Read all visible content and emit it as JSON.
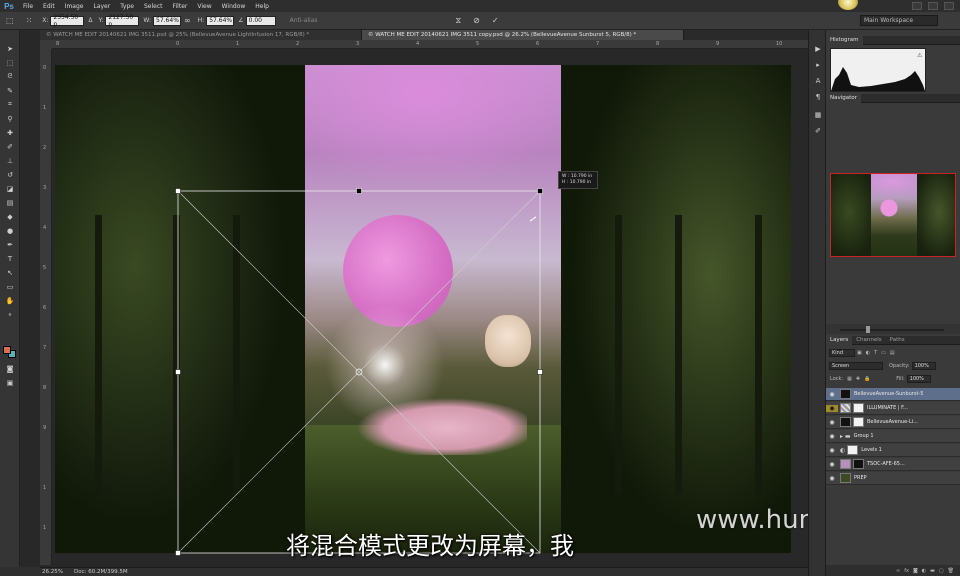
{
  "app": {
    "logo": "Ps",
    "menu": [
      "File",
      "Edit",
      "Image",
      "Layer",
      "Type",
      "Select",
      "Filter",
      "View",
      "Window",
      "Help"
    ]
  },
  "options": {
    "x_label": "X:",
    "x_value": "2554.50 p",
    "y_label": "Y:",
    "y_value": "2127.50 p",
    "w_label": "W:",
    "w_value": "57.64%",
    "h_label": "H:",
    "h_value": "57.64%",
    "angle_value": "0.00",
    "antialias": "Anti-alias",
    "workspace": "Main Workspace"
  },
  "tabs": [
    {
      "label": "© WATCH ME EDIT 20140621 IMG 3511.psd @ 25% (BellevueAvenue LightInfusion 17, RGB/8) *",
      "active": false
    },
    {
      "label": "© WATCH ME EDIT 20140621 IMG 3511 copy.psd @ 26.2% (BellevueAvenue Sunburst 5, RGB/8) *",
      "active": true
    }
  ],
  "rulers": {
    "top": [
      "8",
      "0",
      "1",
      "2",
      "3",
      "4",
      "5",
      "6",
      "7",
      "8",
      "9",
      "10"
    ],
    "left": [
      "0",
      "1",
      "2",
      "3",
      "4",
      "5",
      "6",
      "7",
      "8",
      "9",
      "1",
      "1"
    ]
  },
  "transform_tip": {
    "w": "W : 10.790 in",
    "h": "H : 10.790 in"
  },
  "subtitle": "将混合模式更改为屏幕，我",
  "watermark": "www.hunls.com",
  "status": {
    "zoom": "26.25%",
    "doc": "Doc: 60.2M/399.5M"
  },
  "panels": {
    "histogram_tab": "Histogram",
    "navigator_tab": "Navigator",
    "layers_tabs": [
      "Layers",
      "Channels",
      "Paths"
    ],
    "kind": "Kind",
    "blend_mode": "Screen",
    "opacity_label": "Opacity:",
    "opacity_value": "100%",
    "lock_label": "Lock:",
    "fill_label": "Fill:",
    "fill_value": "100%",
    "layers": [
      {
        "name": "BellevueAvenue-Sunburst-5",
        "selected": true,
        "thumb": "dark"
      },
      {
        "name": "ILLUMINATE | F...",
        "selected": false,
        "thumb": "pattern"
      },
      {
        "name": "BellevueAvenue-Li...",
        "selected": false,
        "thumb": "dark"
      },
      {
        "name": "Group 1",
        "selected": false,
        "thumb": "folder"
      },
      {
        "name": "Levels 1",
        "selected": false,
        "thumb": "white"
      },
      {
        "name": "TSOC-AFE-65...",
        "selected": false,
        "thumb": "dark"
      },
      {
        "name": "PREP",
        "selected": false,
        "thumb": "dark"
      }
    ]
  },
  "colors": {
    "foreground": "#d76e4c",
    "background": "#5ab0b8",
    "selected_layer": "#5d6f8a"
  }
}
